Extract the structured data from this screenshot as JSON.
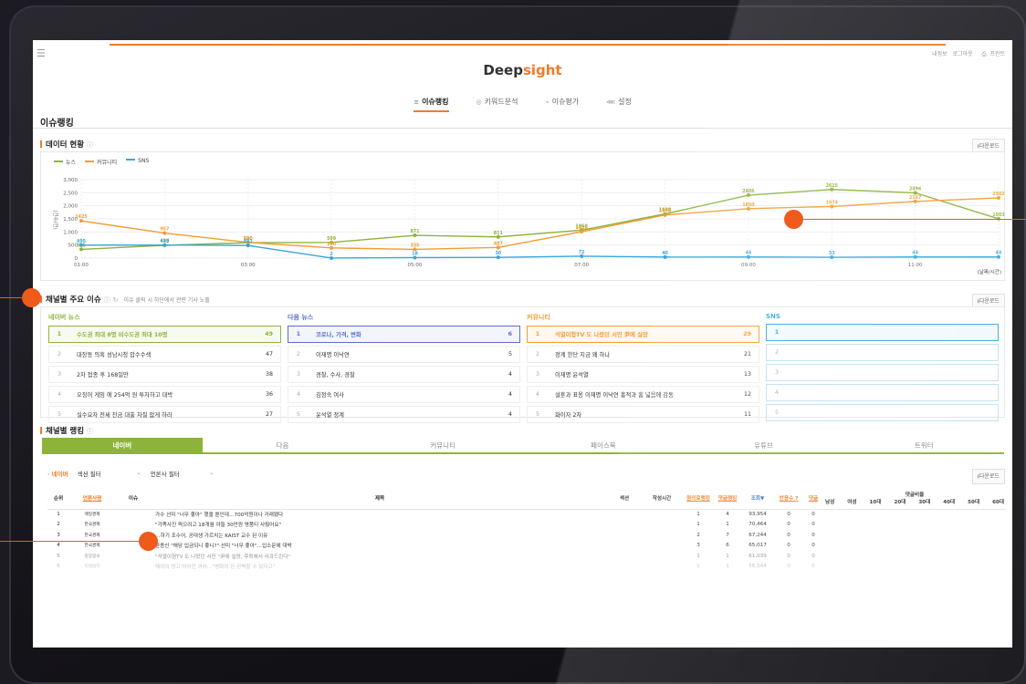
{
  "app": {
    "logo_a": "Deep",
    "logo_b": "sight",
    "util": [
      "내정보",
      "로그아웃",
      "프린트"
    ],
    "nav": [
      {
        "label": "이슈랭킹",
        "icon": "list-icon",
        "active": true
      },
      {
        "label": "키워드분석",
        "icon": "target-icon"
      },
      {
        "label": "이슈평가",
        "icon": "chart-icon"
      },
      {
        "label": "설정",
        "icon": "share-icon"
      }
    ],
    "page_title": "이슈랭킹",
    "download": "다운로드"
  },
  "data_status": {
    "title": "데이터 현황",
    "legend": [
      "뉴스",
      "커뮤니티",
      "SNS"
    ],
    "colors": {
      "news": "#8db33a",
      "community": "#f39c34",
      "sns": "#3aa7d8"
    }
  },
  "chart_data": {
    "type": "line",
    "x": [
      "01:00",
      "02:00",
      "03:00",
      "04:00",
      "05:00",
      "06:00",
      "07:00",
      "08:00",
      "09:00",
      "10:00",
      "11:00",
      "12:00"
    ],
    "x_tick_labels": [
      "01:00",
      "03:00",
      "05:00",
      "07:00",
      "09:00",
      "11:00"
    ],
    "ylabel": "(건수/건)",
    "xlabel": "(날짜/시간)",
    "ylim": [
      0,
      3000
    ],
    "y_ticks": [
      0,
      500,
      "1,000",
      "1,500",
      "2,000",
      "2,500",
      "3,000"
    ],
    "series": [
      {
        "name": "뉴스",
        "color": "#8db33a",
        "values": [
          335,
          488,
          590,
          599,
          871,
          811,
          1068,
          1688,
          2406,
          2625,
          2496,
          1503
        ]
      },
      {
        "name": "커뮤니티",
        "color": "#f39c34",
        "values": [
          1425,
          957,
          600,
          390,
          335,
          407,
          1010,
          1649,
          1890,
          1974,
          2167,
          2302
        ]
      },
      {
        "name": "SNS",
        "color": "#3aa7d8",
        "values": [
          495,
          499,
          483,
          2,
          18,
          30,
          72,
          40,
          44,
          33,
          44,
          44
        ]
      }
    ],
    "grid": true
  },
  "issues": {
    "title": "채널별 주요 이슈",
    "subtitle": "이슈 클릭 시 하단에서 관련 기사 노출",
    "columns": [
      {
        "title": "네이버 뉴스",
        "color": "#8db33a",
        "items": [
          {
            "rank": "1",
            "title": "수도권 최대 8명 비수도권 최대 10명",
            "count": "49"
          },
          {
            "rank": "2",
            "title": "대장동 의혹 성남시청 압수수색",
            "count": "47"
          },
          {
            "rank": "3",
            "title": "2차 접종 후 168일만",
            "count": "38"
          },
          {
            "rank": "4",
            "title": "오징어 게임 에 254억 원 투자하고 대박",
            "count": "36"
          },
          {
            "rank": "5",
            "title": "실수요자 전세 잔금 대출 차질 없게 하라",
            "count": "27"
          }
        ]
      },
      {
        "title": "다음 뉴스",
        "color": "#5b6fc6",
        "items": [
          {
            "rank": "1",
            "title": "코로나, 가격, 변화",
            "count": "6"
          },
          {
            "rank": "2",
            "title": "이재명 이낙연",
            "count": "5"
          },
          {
            "rank": "3",
            "title": "경찰, 수사, 경찰",
            "count": "4"
          },
          {
            "rank": "4",
            "title": "김정숙 여사",
            "count": "4"
          },
          {
            "rank": "5",
            "title": "윤석열 정계",
            "count": "4"
          }
        ]
      },
      {
        "title": "커뮤니티",
        "color": "#f39c34",
        "items": [
          {
            "rank": "1",
            "title": "석열이형TV 도 나왔던 서민 尹에 실망",
            "count": "29"
          },
          {
            "rank": "2",
            "title": "정계 한단 지금 왜 하나",
            "count": "21"
          },
          {
            "rank": "3",
            "title": "이재명 윤석열",
            "count": "13"
          },
          {
            "rank": "4",
            "title": "설훈과 표옹 이재명 이낙연 흥적과 홈 넓음에 감동",
            "count": "12"
          },
          {
            "rank": "5",
            "title": "화이자 2차",
            "count": "11"
          }
        ]
      },
      {
        "title": "SNS",
        "color": "#3aa7d8",
        "items": [
          {
            "rank": "1",
            "title": "",
            "count": ""
          },
          {
            "rank": "2",
            "title": "",
            "count": ""
          },
          {
            "rank": "3",
            "title": "",
            "count": ""
          },
          {
            "rank": "4",
            "title": "",
            "count": ""
          },
          {
            "rank": "5",
            "title": "",
            "count": ""
          }
        ]
      }
    ]
  },
  "ranking": {
    "title": "채널별 랭킹",
    "tabs": [
      "네이버",
      "다음",
      "커뮤니티",
      "페이스북",
      "유튜브",
      "트위터"
    ],
    "filter_label": "· 네이버",
    "filter1": "섹션 필터",
    "filter2": "언론사 필터",
    "headers": {
      "rank": "순위",
      "press": "언론사명",
      "issue": "이슈",
      "title": "제목",
      "section": "섹션",
      "time": "작성시간",
      "naver_rank": "원의료랭킹",
      "comment_rank": "댓글랭킹",
      "views": "조회▼",
      "reactions": "반응수",
      "comments": "댓글",
      "ratio": "댓글비율",
      "ratio_cols": [
        "남성",
        "여성",
        "10대",
        "20대",
        "30대",
        "40대",
        "50대",
        "60대"
      ]
    },
    "rows": [
      {
        "rank": "1",
        "press": "매일경제",
        "title": "가수 선미 \"너무 좋아\" 했을 뿐인데…700억원이나 거래됐다",
        "r1": "1",
        "r2": "4",
        "views": "93,954",
        "re": "0",
        "cm": "0"
      },
      {
        "rank": "2",
        "press": "한국경제",
        "title": "\"가족사진 찍으려고 18개월 아들 30만원 명품티 사줬어요\"",
        "r1": "1",
        "r2": "1",
        "views": "70,464",
        "re": "0",
        "cm": "0"
      },
      {
        "rank": "3",
        "press": "한국경제",
        "title": "…하기 조수어, 공대생 가르치는 KAIST 교수 된 이유",
        "r1": "2",
        "r2": "7",
        "views": "67,244",
        "re": "0",
        "cm": "0"
      },
      {
        "rank": "4",
        "press": "한국경제",
        "title": "윤종신 \"해당 입금되니 좋니?\"·선미 \"너무 좋아\"…입소문에 대박",
        "r1": "3",
        "r2": "6",
        "views": "65,017",
        "re": "0",
        "cm": "0"
      },
      {
        "rank": "5",
        "press": "중앙일보",
        "title": "\"석열이형TV 도 나왔던 서민 \"尹에 실망, 후퇴해서 사과드린다\"",
        "r1": "1",
        "r2": "1",
        "views": "61,039",
        "re": "0",
        "cm": "0"
      },
      {
        "rank": "6",
        "press": "이데일리",
        "title": "해외의 쌍고 아이언 어서…\"영화의 된 완벽할 수 있다고\"",
        "r1": "1",
        "r2": "1",
        "views": "56,544",
        "re": "0",
        "cm": "0"
      }
    ]
  }
}
